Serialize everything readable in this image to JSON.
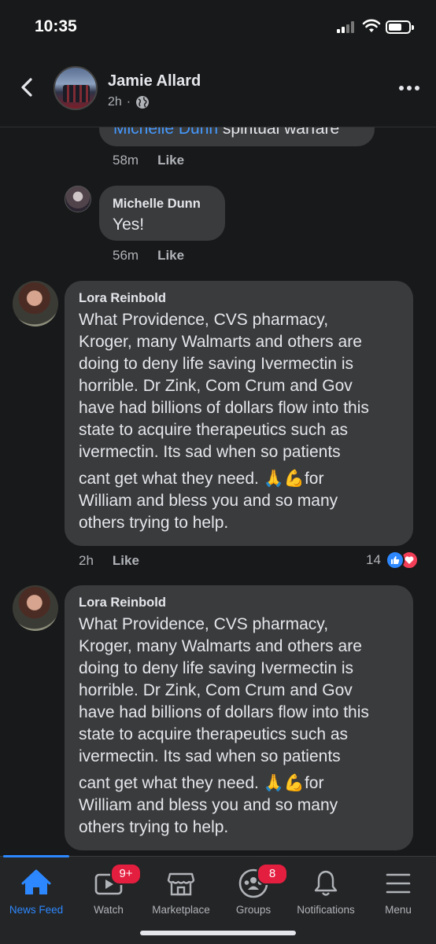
{
  "status_bar": {
    "time": "10:35"
  },
  "header": {
    "name": "Jamie Allard",
    "time": "2h",
    "separator": "·",
    "audience_icon": "globe-icon"
  },
  "comments": [
    {
      "id": "partial",
      "mention": "Michelle Dunn",
      "text": " spiritual warfare",
      "time": "58m",
      "like_label": "Like"
    },
    {
      "id": "reply",
      "author": "Michelle Dunn",
      "text": "Yes!",
      "time": "56m",
      "like_label": "Like"
    },
    {
      "id": "c1",
      "author": "Lora Reinbold",
      "lines": [
        "What Providence, CVS pharmacy,",
        "Kroger, many Walmarts and others  are",
        "doing to deny life saving Ivermectin is",
        "horrible. Dr Zink, Com Crum and Gov",
        "have had billions of dollars flow into this",
        "state to acquire therapeutics such as",
        "ivermectin.  Its sad when so patients",
        "cant get what they need.  🙏💪for",
        "William and bless you and so many",
        "others trying to help."
      ],
      "time": "2h",
      "like_label": "Like",
      "reaction_count": "14",
      "reaction_icons": [
        "like-icon",
        "love-icon"
      ]
    },
    {
      "id": "c2",
      "author": "Lora Reinbold",
      "lines": [
        "What Providence, CVS pharmacy,",
        "Kroger, many Walmarts and others  are",
        "doing to deny life saving Ivermectin is",
        "horrible. Dr Zink, Com Crum and Gov",
        "have had billions of dollars flow into this",
        "state to acquire therapeutics such as",
        "ivermectin.  Its sad when so patients",
        "cant get what they need.  🙏💪for",
        "William and bless you and so many",
        "others trying to help."
      ]
    }
  ],
  "tabbar": {
    "items": [
      {
        "label": "News Feed",
        "icon": "home-icon",
        "active": true
      },
      {
        "label": "Watch",
        "icon": "watch-icon",
        "badge": "9+"
      },
      {
        "label": "Marketplace",
        "icon": "marketplace-icon"
      },
      {
        "label": "Groups",
        "icon": "groups-icon",
        "badge": "8"
      },
      {
        "label": "Notifications",
        "icon": "bell-icon"
      },
      {
        "label": "Menu",
        "icon": "menu-icon"
      }
    ]
  },
  "colors": {
    "background": "#18191a",
    "bubble": "#3a3b3c",
    "accent": "#2d88ff",
    "badge": "#e41e3f",
    "mention": "#4599ff"
  }
}
